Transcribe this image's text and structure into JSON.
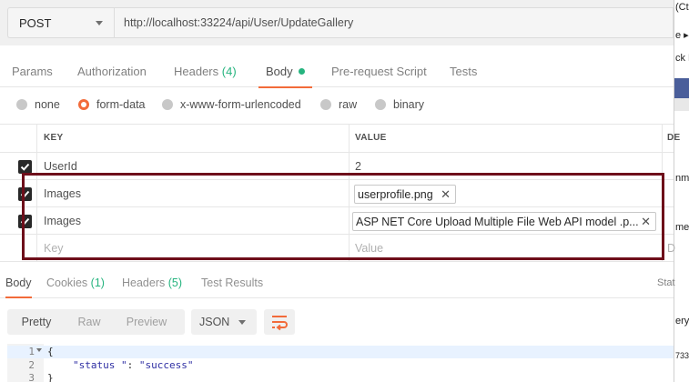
{
  "request": {
    "method": "POST",
    "url": "http://localhost:33224/api/User/UpdateGallery"
  },
  "request_tabs": [
    {
      "label": "Params"
    },
    {
      "label": "Authorization"
    },
    {
      "label": "Headers",
      "count": "(4)"
    },
    {
      "label": "Body",
      "active": true
    },
    {
      "label": "Pre-request Script"
    },
    {
      "label": "Tests"
    }
  ],
  "body_types": [
    {
      "label": "none"
    },
    {
      "label": "form-data",
      "selected": true
    },
    {
      "label": "x-www-form-urlencoded"
    },
    {
      "label": "raw"
    },
    {
      "label": "binary"
    }
  ],
  "table": {
    "key_header": "KEY",
    "value_header": "VALUE",
    "desc_header": "DE",
    "rows": [
      {
        "key": "UserId",
        "value": "2",
        "checked": true
      },
      {
        "key": "Images",
        "file": "userprofile.png",
        "checked": true
      },
      {
        "key": "Images",
        "file": "ASP NET Core Upload Multiple File Web API model .p...",
        "checked": true
      }
    ],
    "key_placeholder": "Key",
    "value_placeholder": "Value",
    "desc_placeholder": "D"
  },
  "response_tabs": [
    {
      "label": "Body",
      "active": true
    },
    {
      "label": "Cookies",
      "count": "(1)"
    },
    {
      "label": "Headers",
      "count": "(5)"
    },
    {
      "label": "Test Results"
    }
  ],
  "status_label": "Stat",
  "view_modes": [
    "Pretty",
    "Raw",
    "Preview"
  ],
  "format": "JSON",
  "code_lines": [
    {
      "n": "1",
      "text": "{"
    },
    {
      "n": "2",
      "key": "\"status \"",
      "sep": ": ",
      "val": "\"success\""
    },
    {
      "n": "3",
      "text": "}"
    }
  ],
  "right_edge": {
    "lines": [
      "(Ct",
      "e ▸",
      "ck F",
      "nme",
      "med",
      "ery",
      "733"
    ]
  },
  "colors": {
    "accent": "#f26b3a",
    "count_green": "#26b47f",
    "highlight_border": "#6e0e1a"
  }
}
